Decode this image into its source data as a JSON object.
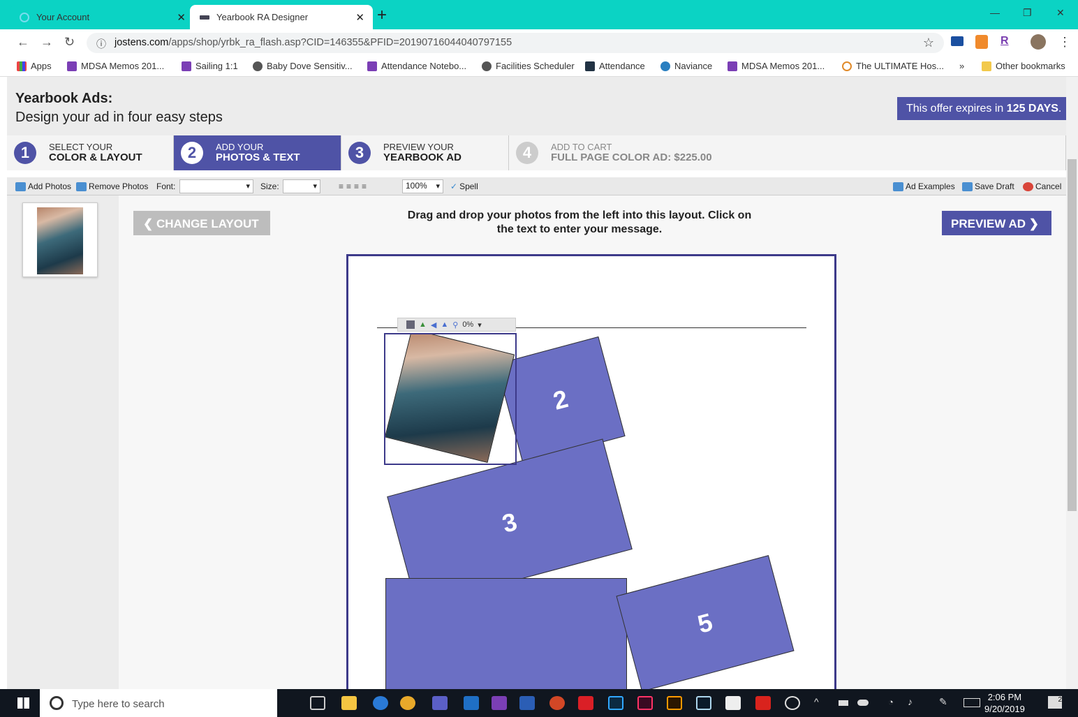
{
  "browser": {
    "tabs": [
      {
        "title": "Your Account",
        "active": false
      },
      {
        "title": "Yearbook RA Designer",
        "active": true
      }
    ],
    "url_host": "jostens.com",
    "url_path": "/apps/shop/yrbk_ra_flash.asp?CID=146355&PFID=20190716044040797155",
    "bookmarks": [
      "Apps",
      "MDSA Memos 201...",
      "Sailing 1:1",
      "Baby Dove Sensitiv...",
      "Attendance Notebo...",
      "Facilities Scheduler",
      "Attendance",
      "Naviance",
      "MDSA Memos 201...",
      "The ULTIMATE Hos...",
      "»",
      "Other bookmarks"
    ]
  },
  "header": {
    "title": "Yearbook Ads:",
    "subtitle": "Design your ad in four easy steps",
    "offer_prefix": "This offer expires in",
    "offer_days": "125 DAYS",
    "offer_suffix": "."
  },
  "steps": [
    {
      "num": "1",
      "line1": "SELECT YOUR",
      "line2": "COLOR & LAYOUT",
      "state": "done"
    },
    {
      "num": "2",
      "line1": "ADD YOUR",
      "line2": "PHOTOS & TEXT",
      "state": "current"
    },
    {
      "num": "3",
      "line1": "PREVIEW YOUR",
      "line2": "YEARBOOK AD",
      "state": "next"
    },
    {
      "num": "4",
      "line1": "ADD TO CART",
      "line2": "FULL PAGE COLOR AD: $225.00",
      "state": "disabled"
    }
  ],
  "toolbar": {
    "add_photos": "Add Photos",
    "remove_photos": "Remove Photos",
    "font_label": "Font:",
    "size_label": "Size:",
    "zoom": "100%",
    "spell": "Spell",
    "ad_examples": "Ad Examples",
    "save_draft": "Save Draft",
    "cancel": "Cancel"
  },
  "workspace": {
    "change_layout": "CHANGE LAYOUT",
    "instructions": "Drag and drop your photos from the left into this layout. Click on the text to enter your message.",
    "preview_ad": "PREVIEW AD",
    "photo_zoom": "0%",
    "photo_blocks": [
      {
        "label": "2"
      },
      {
        "label": "3"
      },
      {
        "label": ""
      },
      {
        "label": "5"
      }
    ]
  },
  "taskbar": {
    "search_placeholder": "Type here to search",
    "time": "2:06 PM",
    "date": "9/20/2019",
    "notifications": "2"
  },
  "colors": {
    "accent": "#4f53a6",
    "tab_bar": "#0bd3c4",
    "block_fill": "#6b6fc4"
  }
}
